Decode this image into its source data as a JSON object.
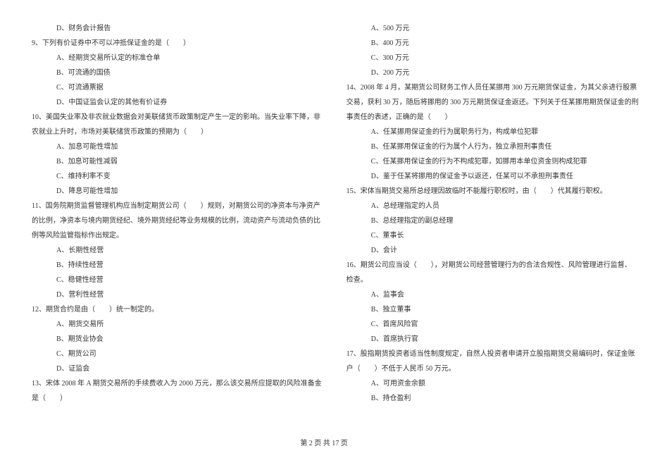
{
  "left_column": {
    "lines": [
      {
        "text": "D、财务会计报告",
        "indent": 1
      },
      {
        "text": "9、下列有价证券中不可以冲抵保证金的是（　　）",
        "indent": 2
      },
      {
        "text": "A、经期货交易所认定的标准仓单",
        "indent": 1
      },
      {
        "text": "B、可流通的国债",
        "indent": 1
      },
      {
        "text": "C、可流通票据",
        "indent": 1
      },
      {
        "text": "D、中国证监会认定的其他有价证券",
        "indent": 1
      },
      {
        "text": "10、美国失业率及非农就业数据会对美联储货币政策制定产生一定的影响。当失业率下降，非",
        "indent": 2
      },
      {
        "text": "农就业上升时，市场对美联储货币政策的预期为（　　）",
        "indent": 2
      },
      {
        "text": "A、加息可能性增加",
        "indent": 1
      },
      {
        "text": "B、加息可能性减弱",
        "indent": 1
      },
      {
        "text": "C、维持利率不变",
        "indent": 1
      },
      {
        "text": "D、降息可能性增加",
        "indent": 1
      },
      {
        "text": "11、国务院期货监督管理机构应当制定期货公司（　　）规则，对期货公司的净资本与净资产",
        "indent": 2
      },
      {
        "text": "的比例，净资本与境内期货经纪、境外期货经纪等业务规模的比例，流动资产与流动负债的比",
        "indent": 2
      },
      {
        "text": "例等风险监管指标作出规定。",
        "indent": 2
      },
      {
        "text": "A、长期性经营",
        "indent": 1
      },
      {
        "text": "B、持续性经营",
        "indent": 1
      },
      {
        "text": "C、稳健性经营",
        "indent": 1
      },
      {
        "text": "D、营利性经营",
        "indent": 1
      },
      {
        "text": "12、期货合约是由（　　）统一制定的。",
        "indent": 2
      },
      {
        "text": "A、期货交易所",
        "indent": 1
      },
      {
        "text": "B、期货业协会",
        "indent": 1
      },
      {
        "text": "C、期货公司",
        "indent": 1
      },
      {
        "text": "D、证监会",
        "indent": 1
      },
      {
        "text": "13、宋体 2008 年 A 期货交易所的手续费收入为 2000 万元，那么该交易所应提取的风险准备金",
        "indent": 2
      },
      {
        "text": "是（　　）",
        "indent": 2
      }
    ]
  },
  "right_column": {
    "lines": [
      {
        "text": "A、500 万元",
        "indent": 1
      },
      {
        "text": "B、400 万元",
        "indent": 1
      },
      {
        "text": "C、300 万元",
        "indent": 1
      },
      {
        "text": "D、200 万元",
        "indent": 1
      },
      {
        "text": "14、2008 年 4 月，某期货公司财务工作人员任某挪用 300 万元期货保证金，为其父亲进行股票",
        "indent": 2
      },
      {
        "text": "交易，获利 30 万，随后将挪用的 300 万元期货保证金返还。下列关于任某挪用期货保证金的刑",
        "indent": 2
      },
      {
        "text": "事责任的表述，正确的是（　　）",
        "indent": 2
      },
      {
        "text": "A、任某挪用保证金的行为属职务行为，构成单位犯罪",
        "indent": 1
      },
      {
        "text": "B、任某挪用保证金的行为属个人行为，独立承担刑事责任",
        "indent": 1
      },
      {
        "text": "C、任某挪用保证金的行为不构成犯罪，如挪用本单位资金则构成犯罪",
        "indent": 1
      },
      {
        "text": "D、鉴于任某将挪用的保证金予以返还，任某可以不承担刑事责任",
        "indent": 1
      },
      {
        "text": "15、宋体当期货交易所总经理因故临时不能履行职权时，由（　　）代其履行职权。",
        "indent": 2
      },
      {
        "text": "A、总经理指定的人员",
        "indent": 1
      },
      {
        "text": "B、总经理指定的副总经理",
        "indent": 1
      },
      {
        "text": "C、董事长",
        "indent": 1
      },
      {
        "text": "D、会计",
        "indent": 1
      },
      {
        "text": "16、期货公司应当设（　　），对期货公司经营管理行为的合法合规性、风险管理进行监督、",
        "indent": 2
      },
      {
        "text": "检查。",
        "indent": 2
      },
      {
        "text": "A、监事会",
        "indent": 1
      },
      {
        "text": "B、独立董事",
        "indent": 1
      },
      {
        "text": "C、首席风险官",
        "indent": 1
      },
      {
        "text": "D、首席执行官",
        "indent": 1
      },
      {
        "text": "17、股指期货投资者适当性制度规定，自然人投资者申请开立股指期货交易编码时，保证金账",
        "indent": 2
      },
      {
        "text": "户（　　）不低于人民币 50 万元。",
        "indent": 2
      },
      {
        "text": "A、可用资金余额",
        "indent": 1
      },
      {
        "text": "B、持仓盈利",
        "indent": 1
      }
    ]
  },
  "footer": {
    "text": "第 2 页 共 17 页"
  }
}
